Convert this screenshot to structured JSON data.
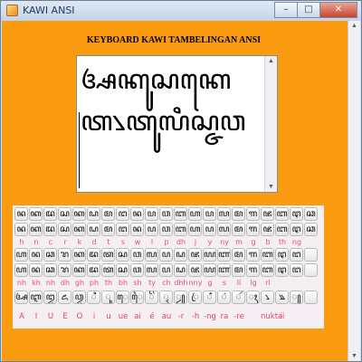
{
  "window": {
    "title": "KAWI ANSI",
    "minimize": "–",
    "maximize": "□",
    "close": "✕"
  },
  "heading": "KEYBOARD KAWI TAMBELINGAN ANSI",
  "editor": {
    "text": "ꦄꦏꦸꦱꦏꦺꦠ꧈ꦠꦸꦭꦶꦱ꧀ꦗꦮ"
  },
  "keyboard": {
    "row1": [
      "ꦤ",
      "ꦏ",
      "ꦢ",
      "ꦱ",
      "ꦏ",
      "ꦝ",
      "ꦩ",
      "ꦔ",
      "ꦤ",
      "ꦥ",
      "ꦮ",
      "ꦧ",
      "ꦲ",
      "ꦥ",
      "ꦭ",
      "ꦩ",
      "ꦒ",
      "ꦗ",
      "ꦧ",
      "ꦛ",
      "ꦕ"
    ],
    "row2": [
      "ꦤ",
      "ꦏ",
      "ꦢ",
      "ꦱ",
      "ꦏ",
      "ꦝ",
      "ꦩ",
      "ꦔ",
      "ꦤ",
      "ꦥ",
      "ꦮ",
      "ꦧ",
      "ꦲ",
      "ꦥ",
      "ꦭ",
      "ꦩ",
      "ꦒ",
      "ꦗ",
      "ꦧ",
      "ꦛ",
      "ꦕ"
    ],
    "labels1": [
      "h",
      "n",
      "c",
      "r",
      "k",
      "d",
      "t",
      "s",
      "w",
      "l",
      "p",
      "dh",
      "j",
      "y",
      "ny",
      "m",
      "g",
      "b",
      "th",
      "ng",
      ""
    ],
    "row3": [
      "ꦲ",
      "ꦤ",
      "ꦕ",
      "ꦫ",
      "ꦏ",
      "ꦢ",
      "ꦠ",
      "ꦱ",
      "ꦮ",
      "ꦭ",
      "ꦥ",
      "ꦝ",
      "ꦗ",
      "ꦪ",
      "ꦚ",
      "ꦩ",
      "ꦒ",
      "ꦧ",
      "ꦛ",
      "ꦔ",
      ""
    ],
    "row4": [
      "ꦲ",
      "ꦤ",
      "ꦕ",
      "ꦫ",
      "ꦏ",
      "ꦢ",
      "ꦠ",
      "ꦱ",
      "ꦮ",
      "ꦭ",
      "ꦥ",
      "ꦝ",
      "ꦗ",
      "ꦪ",
      "ꦚ",
      "ꦩ",
      "ꦒ",
      "ꦧ",
      "ꦛ",
      "ꦔ",
      ""
    ],
    "labels2": [
      "nh",
      "kh",
      "nh",
      "dh",
      "gh",
      "ph",
      "th",
      "bh",
      "sh",
      "ty",
      "ch",
      "dhh",
      "nny",
      "g",
      "s",
      "ll",
      "lg",
      "rl",
      "",
      ""
    ],
    "row5": [
      "ꦄ",
      "ꦆ",
      "ꦈ",
      "ꦌ",
      "ꦎ",
      "ꦶ",
      "ꦸ",
      "ꦺ",
      "ꦻ",
      "ꦼ",
      "ꦽ",
      "ꦾ",
      "ꦿ",
      "ꦀ",
      "ꦁ",
      "ꦂ",
      "ꦃ",
      "꧈",
      "꧉",
      "꧀",
      ""
    ],
    "labels3": [
      "A",
      "I",
      "U",
      "E",
      "O",
      "i",
      "u",
      "ue",
      "ai",
      "é",
      "au",
      "-r",
      "-h",
      "-ng",
      "ra",
      "-re",
      "",
      "nukta",
      "ii",
      "",
      ""
    ]
  }
}
